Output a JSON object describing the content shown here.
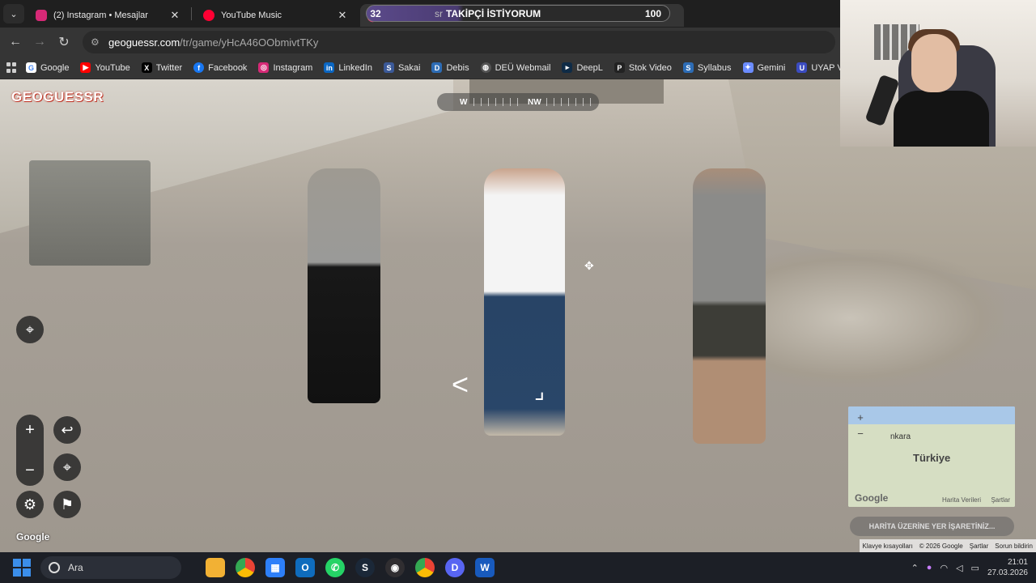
{
  "browser": {
    "tabs": [
      {
        "title": "(2) Instagram • Mesajlar",
        "favicon_color": "#d62976",
        "icon": "instagram-icon"
      },
      {
        "title": "YouTube Music",
        "favicon_color": "#ff0033",
        "icon": "youtube-music-icon"
      },
      {
        "title": "",
        "favicon_color": "#e0447c",
        "icon": "geoguessr-pin-icon"
      }
    ],
    "banner": {
      "left": "32",
      "mid_prefix": "sr",
      "mid": "TAKİPÇİ İSTİYORUM",
      "right": "100"
    },
    "url": {
      "host": "geoguessr.com",
      "path": "/tr/game/yHcA46OObmivtTKy"
    },
    "bookmarks": [
      {
        "label": "Google",
        "icon": "google-icon",
        "color": "#4285f4",
        "glyph": "G"
      },
      {
        "label": "YouTube",
        "icon": "youtube-icon",
        "color": "#ff0000",
        "glyph": "▶"
      },
      {
        "label": "Twitter",
        "icon": "x-icon",
        "color": "#000000",
        "glyph": "X"
      },
      {
        "label": "Facebook",
        "icon": "facebook-icon",
        "color": "#1877f2",
        "glyph": "f"
      },
      {
        "label": "Instagram",
        "icon": "instagram-icon",
        "color": "#d62976",
        "glyph": "◎"
      },
      {
        "label": "LinkedIn",
        "icon": "linkedin-icon",
        "color": "#0a66c2",
        "glyph": "in"
      },
      {
        "label": "Sakai",
        "icon": "sakai-icon",
        "color": "#3b5998",
        "glyph": "S"
      },
      {
        "label": "Debis",
        "icon": "debis-icon",
        "color": "#2d6cb5",
        "glyph": "D"
      },
      {
        "label": "DEÜ Webmail",
        "icon": "globe-icon",
        "color": "#555555",
        "glyph": "◍"
      },
      {
        "label": "DeepL",
        "icon": "deepl-icon",
        "color": "#0f2b46",
        "glyph": "▸"
      },
      {
        "label": "Stok Video",
        "icon": "stock-video-icon",
        "color": "#222222",
        "glyph": "P"
      },
      {
        "label": "Syllabus",
        "icon": "syllabus-icon",
        "color": "#2d6cb5",
        "glyph": "S"
      },
      {
        "label": "Gemini",
        "icon": "gemini-icon",
        "color": "#6b8cff",
        "glyph": "✦"
      },
      {
        "label": "UYAP Vatandaş",
        "icon": "uyap-icon",
        "color": "#3b4cc0",
        "glyph": "U"
      }
    ]
  },
  "game": {
    "logo": "GEOGUESSR",
    "compass": {
      "w": "W",
      "nw": "NW"
    },
    "google_watermark": "Google",
    "minimap": {
      "city": "nkara",
      "country": "Türkiye",
      "zoom_in": "+",
      "zoom_out": "−",
      "google": "Google",
      "keys": "Harita Verileri",
      "terms": "Şartlar"
    },
    "guess_button": "HARİTA ÜZERİNE YER İŞARETİNİZ...",
    "attribution": {
      "shortcuts": "Klavye kısayolları",
      "copyright": "© 2026 Google",
      "terms": "Şartlar",
      "report": "Sorun bildirin"
    }
  },
  "taskbar": {
    "search_placeholder": "Ara",
    "time": "21:01",
    "date": "27.03.2026",
    "apps": [
      {
        "icon": "file-explorer-icon",
        "color": "#f2b134",
        "glyph": ""
      },
      {
        "icon": "chrome-icon",
        "color": "#ea4335",
        "glyph": "●"
      },
      {
        "icon": "ms-store-icon",
        "color": "#2d7ff9",
        "glyph": "▦"
      },
      {
        "icon": "outlook-icon",
        "color": "#0f6cbd",
        "glyph": "O"
      },
      {
        "icon": "whatsapp-icon",
        "color": "#25d366",
        "glyph": "✆"
      },
      {
        "icon": "steam-icon",
        "color": "#1b2838",
        "glyph": "S"
      },
      {
        "icon": "obs-icon",
        "color": "#302e31",
        "glyph": "◉"
      },
      {
        "icon": "chrome-profile-icon",
        "color": "#ea4335",
        "glyph": "●"
      },
      {
        "icon": "discord-icon",
        "color": "#5865f2",
        "glyph": "D"
      },
      {
        "icon": "word-icon",
        "color": "#185abd",
        "glyph": "W"
      }
    ]
  }
}
